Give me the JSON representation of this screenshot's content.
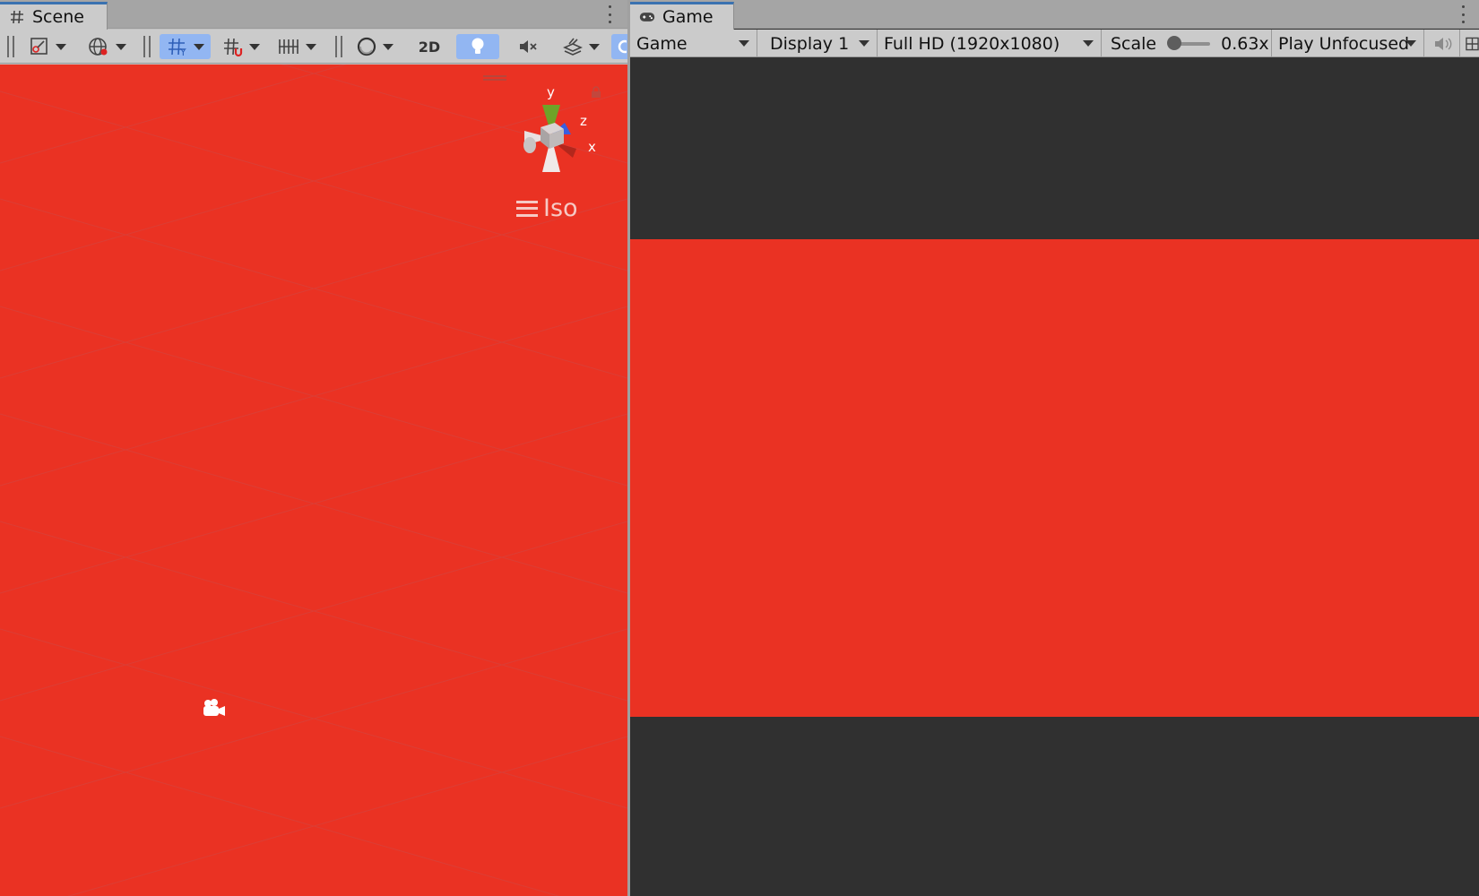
{
  "scene": {
    "tab_label": "Scene",
    "toolbar": {
      "mode_2d_label": "2D"
    },
    "gizmo": {
      "axis_y": "y",
      "axis_z": "z",
      "axis_x": "x"
    },
    "projection_label": "Iso",
    "background_color": "#ea3223"
  },
  "game": {
    "tab_label": "Game",
    "toolbar": {
      "view_select": "Game",
      "display_select": "Display 1",
      "resolution_select": "Full HD (1920x1080)",
      "scale_label": "Scale",
      "scale_value": "0.63x",
      "play_mode_select": "Play Unfocused"
    },
    "letterbox_color": "#303030",
    "viewport_color": "#ea3223"
  },
  "colors": {
    "active_tool": "#92b6f2",
    "tab_accent": "#3a72b0"
  }
}
